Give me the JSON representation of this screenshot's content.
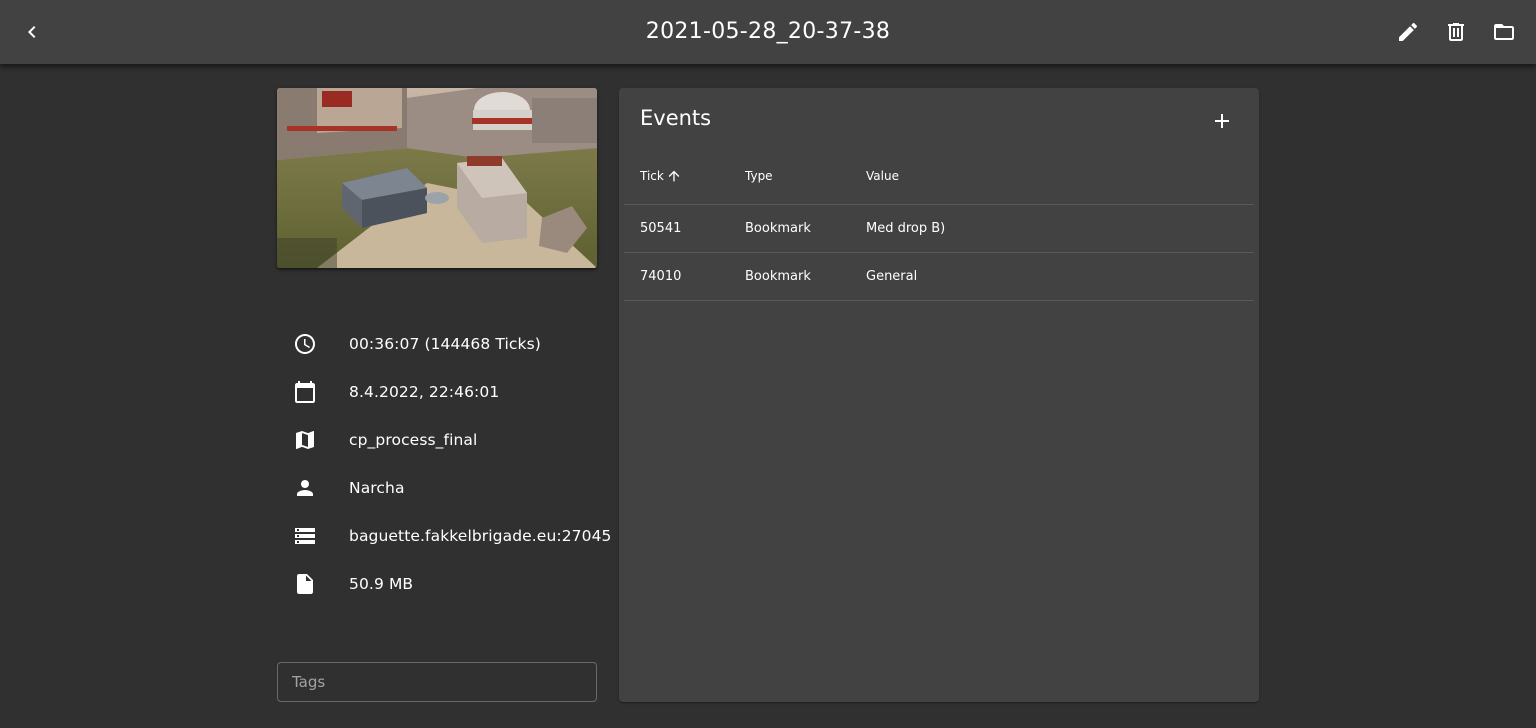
{
  "appbar": {
    "title": "2021-05-28_20-37-38",
    "icons": {
      "back": "chevron-left-icon",
      "edit": "pencil-icon",
      "delete": "trash-icon",
      "folder": "folder-icon"
    }
  },
  "details": {
    "duration": "00:36:07 (144468 Ticks)",
    "date": "8.4.2022, 22:46:01",
    "map": "cp_process_final",
    "player": "Narcha",
    "server": "baguette.fakkelbrigade.eu:27045",
    "file_size": "50.9 MB"
  },
  "tags": {
    "placeholder": "Tags",
    "value": ""
  },
  "events": {
    "title": "Events",
    "add_icon": "plus-icon",
    "columns": {
      "tick": "Tick",
      "type": "Type",
      "value": "Value"
    },
    "sort": {
      "column": "tick",
      "direction": "ascending",
      "icon": "arrow-up-icon"
    },
    "rows": [
      {
        "tick": "50541",
        "type": "Bookmark",
        "value": "Med drop B)"
      },
      {
        "tick": "74010",
        "type": "Bookmark",
        "value": "General"
      }
    ]
  },
  "colors": {
    "background": "#303030",
    "surface": "#424242",
    "text": "#ffffff"
  }
}
